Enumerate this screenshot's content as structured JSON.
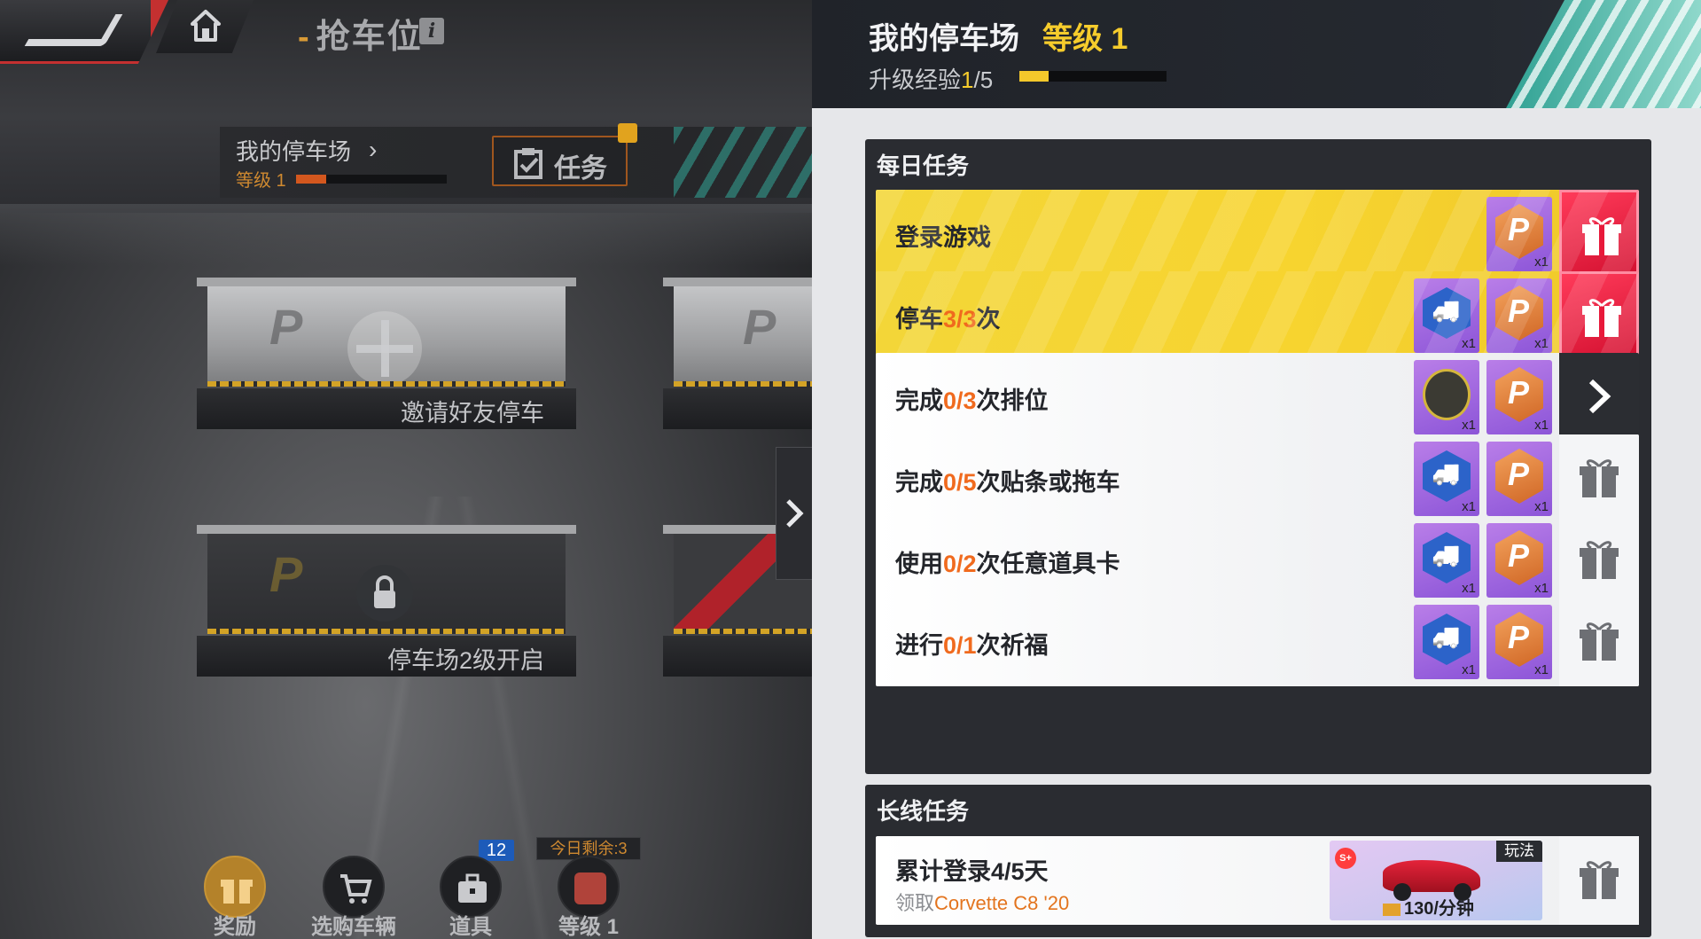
{
  "topbar": {
    "title": "抢车位",
    "title_dash": "-",
    "info_label": "i"
  },
  "parking_panel": {
    "title": "我的停车场",
    "chevron": "›",
    "level_label": "等级 1",
    "exp_fraction": 0.2,
    "task_button_label": "任务"
  },
  "bays": [
    {
      "caption": "邀请好友停车",
      "state": "invite"
    },
    {
      "caption": "停车场2级开启",
      "state": "locked"
    }
  ],
  "dock": {
    "reward_label": "奖励",
    "shop_label": "选购车辆",
    "items_label": "道具",
    "items_count": "12",
    "level_label": "等级 1",
    "today_remaining": "今日剩余:3"
  },
  "task_panel": {
    "title": "我的停车场",
    "level": "等级 1",
    "exp_label": "升级经验",
    "exp_current": "1",
    "exp_total": "/5",
    "exp_fraction": 0.2,
    "daily_title": "每日任务",
    "long_title": "长线任务",
    "daily_tasks": [
      {
        "pre": "登录游戏",
        "prog": "",
        "post": "",
        "state": "claim",
        "rewards": [
          "coin"
        ]
      },
      {
        "pre": "停车",
        "prog": "3/3",
        "post": "次",
        "state": "claim",
        "rewards": [
          "tow",
          "coin"
        ]
      },
      {
        "pre": "完成",
        "prog": "0/3",
        "post": "次排位",
        "state": "go",
        "rewards": [
          "rank",
          "coin"
        ]
      },
      {
        "pre": "完成",
        "prog": "0/5",
        "post": "次贴条或拖车",
        "state": "locked",
        "rewards": [
          "tow",
          "coin"
        ]
      },
      {
        "pre": "使用",
        "prog": "0/2",
        "post": "次任意道具卡",
        "state": "locked",
        "rewards": [
          "tow",
          "coin"
        ]
      },
      {
        "pre": "进行",
        "prog": "0/1",
        "post": "次祈福",
        "state": "locked",
        "rewards": [
          "tow",
          "coin"
        ]
      }
    ],
    "reward_qty": "x1",
    "long_task": {
      "title": "累计登录4/5天",
      "claim_prefix": "领取",
      "car_name": "Corvette C8 '20",
      "card_tag": "玩法",
      "card_rank": "S+",
      "rate": "130/分钟"
    }
  },
  "colors": {
    "accent_yellow": "#f6cc2c",
    "progress_orange": "#f06a1e",
    "claim_red": "#e8193a",
    "teal_stripe": "#2fa193"
  }
}
